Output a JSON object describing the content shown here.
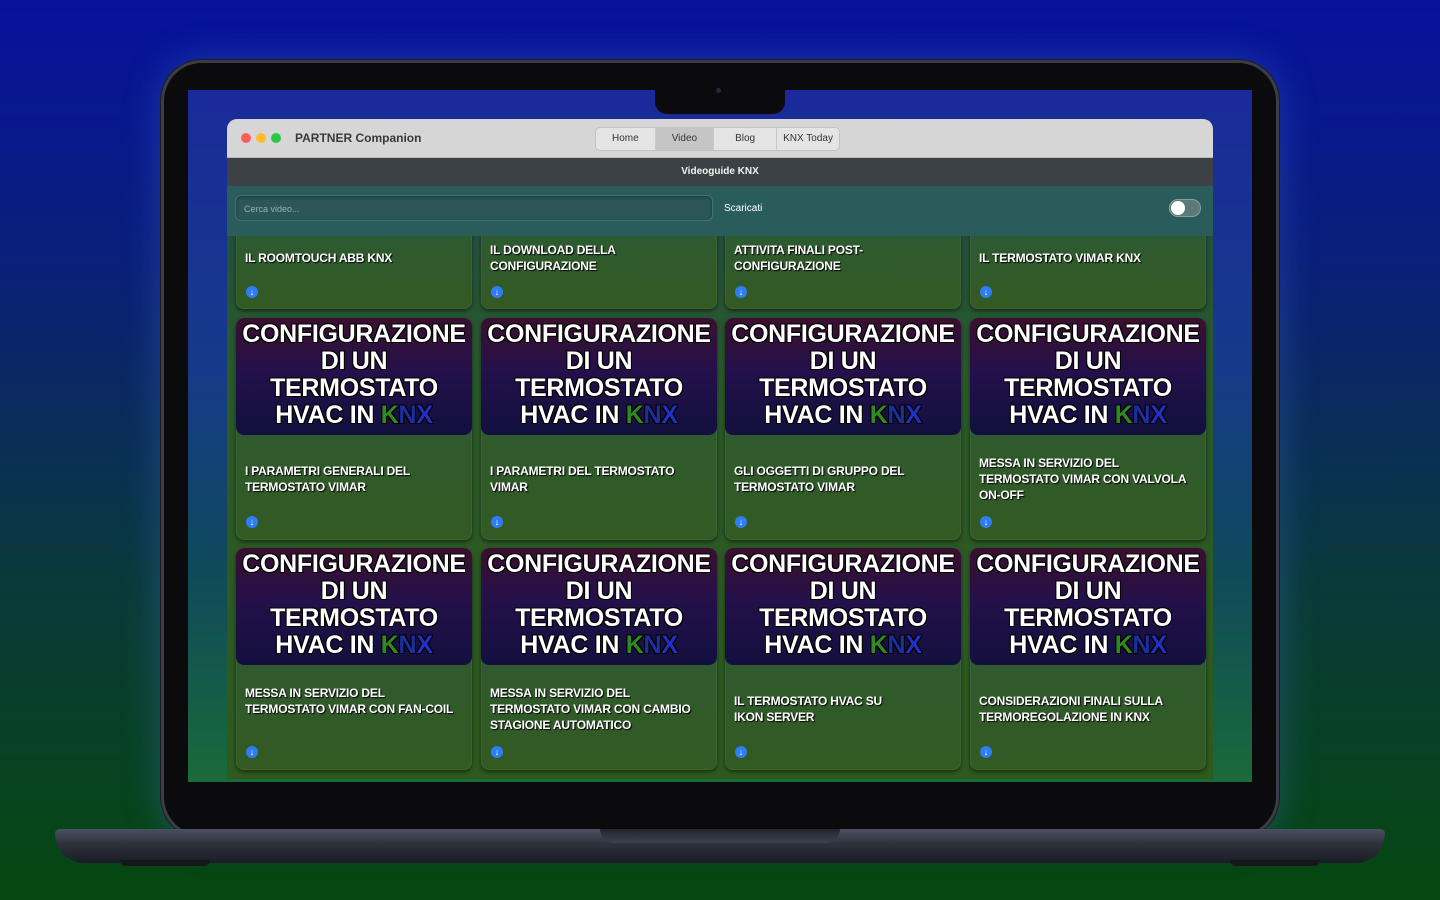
{
  "app": {
    "title": "PARTNER Companion",
    "tabs": [
      {
        "label": "Home",
        "active": false
      },
      {
        "label": "Video",
        "active": true
      },
      {
        "label": "Blog",
        "active": false
      },
      {
        "label": "KNX Today",
        "active": false
      }
    ],
    "nav_title": "Videoguide KNX",
    "search": {
      "placeholder": "Cerca video...",
      "value": ""
    },
    "downloaded_toggle": {
      "label": "Scaricati",
      "on": false
    }
  },
  "thumbnail": {
    "line1": "CONFIGURAZIONE",
    "line2": "DI UN",
    "line3": "TERMOSTATO",
    "line4_prefix": "HVAC IN ",
    "knx_k": "K",
    "knx_n": "N",
    "knx_x": "X"
  },
  "videos": [
    {
      "title": "IL ROOMTOUCH ABB KNX"
    },
    {
      "title": "IL DOWNLOAD DELLA CONFIGURAZIONE"
    },
    {
      "title": "ATTIVITA FINALI POST-CONFIGURAZIONE"
    },
    {
      "title": "IL TERMOSTATO VIMAR KNX"
    },
    {
      "title": "I PARAMETRI GENERALI DEL TERMOSTATO VIMAR"
    },
    {
      "title": "I PARAMETRI DEL TERMOSTATO VIMAR"
    },
    {
      "title": "GLI OGGETTI DI GRUPPO DEL TERMOSTATO VIMAR"
    },
    {
      "title": "MESSA IN SERVIZIO DEL TERMOSTATO VIMAR CON VALVOLA ON-OFF"
    },
    {
      "title": "MESSA IN SERVIZIO DEL TERMOSTATO VIMAR CON FAN-COIL"
    },
    {
      "title": "MESSA IN SERVIZIO DEL TERMOSTATO VIMAR CON CAMBIO STAGIONE AUTOMATICO"
    },
    {
      "title": "IL TERMOSTATO HVAC SU IKON SERVER"
    },
    {
      "title": "CONSIDERAZIONI FINALI SULLA TERMOREGOLAZIONE IN KNX"
    }
  ],
  "icons": {
    "download": "download-icon"
  },
  "colors": {
    "accent": "#2f7df5",
    "knx_green": "#2e8b1f",
    "knx_blue": "#2030c8"
  }
}
